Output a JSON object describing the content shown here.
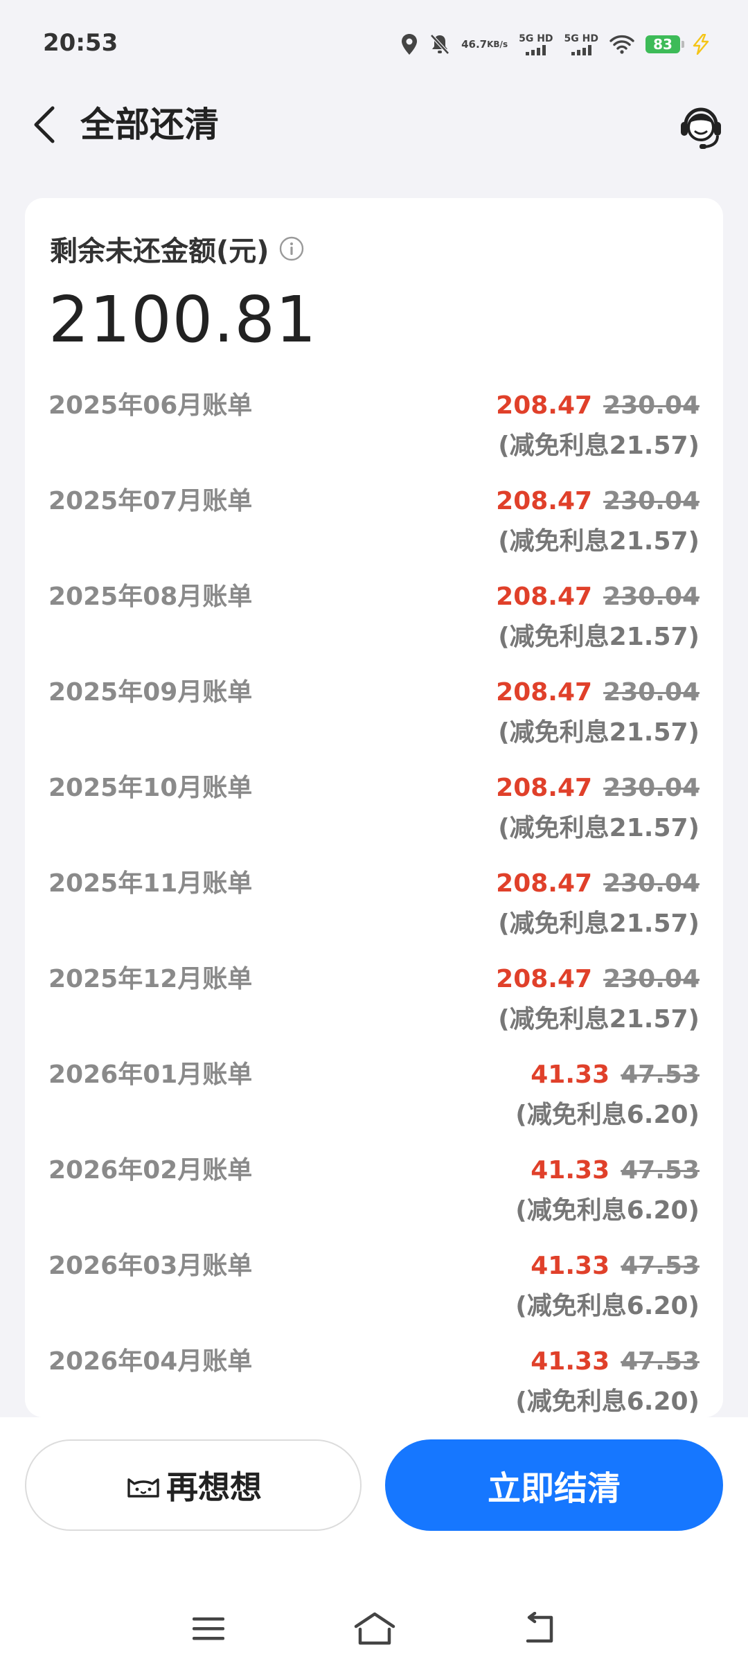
{
  "status": {
    "time": "20:53",
    "net_speed_value": "46.7",
    "net_speed_unit": "KB/s",
    "signal1": "5G HD",
    "signal2": "5G HD",
    "battery": "83",
    "colors": {
      "battery": "#3dbb58",
      "charging": "#f5c518"
    }
  },
  "header": {
    "title": "全部还清",
    "back_icon": "chevron-left-icon",
    "service_icon": "customer-service-icon"
  },
  "summary": {
    "label": "剩余未还金额(元)",
    "amount": "2100.81"
  },
  "bills": [
    {
      "month": "2025年06月账单",
      "amount": "208.47",
      "original": "230.04",
      "discount": "(减免利息21.57)"
    },
    {
      "month": "2025年07月账单",
      "amount": "208.47",
      "original": "230.04",
      "discount": "(减免利息21.57)"
    },
    {
      "month": "2025年08月账单",
      "amount": "208.47",
      "original": "230.04",
      "discount": "(减免利息21.57)"
    },
    {
      "month": "2025年09月账单",
      "amount": "208.47",
      "original": "230.04",
      "discount": "(减免利息21.57)"
    },
    {
      "month": "2025年10月账单",
      "amount": "208.47",
      "original": "230.04",
      "discount": "(减免利息21.57)"
    },
    {
      "month": "2025年11月账单",
      "amount": "208.47",
      "original": "230.04",
      "discount": "(减免利息21.57)"
    },
    {
      "month": "2025年12月账单",
      "amount": "208.47",
      "original": "230.04",
      "discount": "(减免利息21.57)"
    },
    {
      "month": "2026年01月账单",
      "amount": "41.33",
      "original": "47.53",
      "discount": "(减免利息6.20)"
    },
    {
      "month": "2026年02月账单",
      "amount": "41.33",
      "original": "47.53",
      "discount": "(减免利息6.20)"
    },
    {
      "month": "2026年03月账单",
      "amount": "41.33",
      "original": "47.53",
      "discount": "(减免利息6.20)"
    },
    {
      "month": "2026年04月账单",
      "amount": "41.33",
      "original": "47.53",
      "discount": "(减免利息6.20)"
    }
  ],
  "footer": {
    "think_label": "再想想",
    "settle_label": "立即结清",
    "colors": {
      "accent": "#1677ff",
      "discount_amount": "#e0402a"
    }
  },
  "nav": {
    "menu_icon": "menu-icon",
    "home_icon": "home-icon",
    "back_icon": "back-icon"
  }
}
